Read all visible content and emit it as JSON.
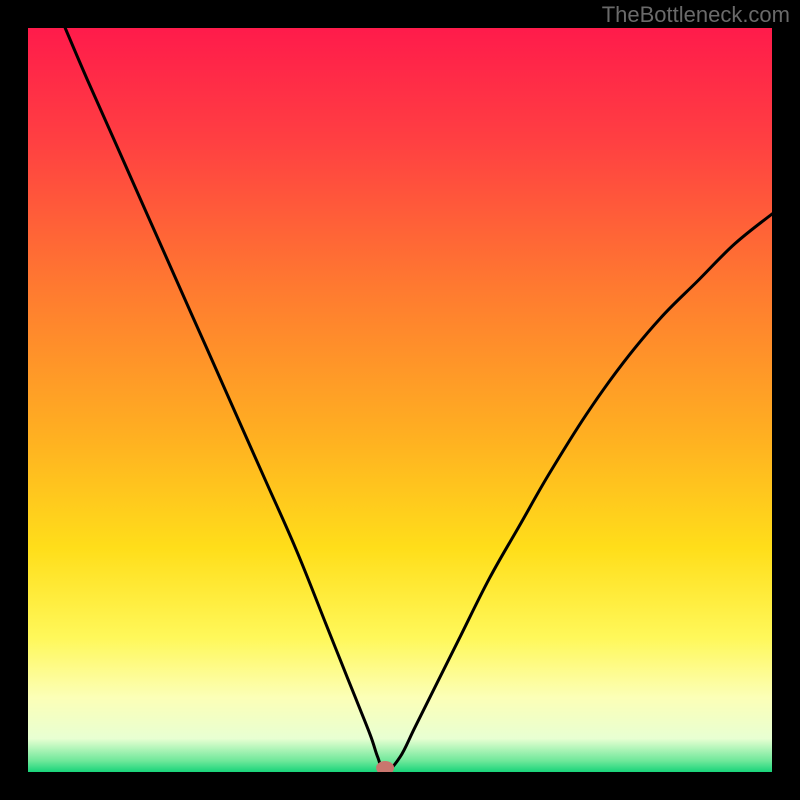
{
  "watermark": "TheBottleneck.com",
  "chart_data": {
    "type": "line",
    "title": "",
    "xlabel": "",
    "ylabel": "",
    "xlim": [
      0,
      100
    ],
    "ylim": [
      0,
      100
    ],
    "background_gradient_stops": [
      {
        "offset": 0,
        "color": "#ff1b4b"
      },
      {
        "offset": 0.15,
        "color": "#ff3f42"
      },
      {
        "offset": 0.35,
        "color": "#ff7a30"
      },
      {
        "offset": 0.55,
        "color": "#ffb021"
      },
      {
        "offset": 0.7,
        "color": "#ffde1a"
      },
      {
        "offset": 0.82,
        "color": "#fff85a"
      },
      {
        "offset": 0.9,
        "color": "#fcffb7"
      },
      {
        "offset": 0.955,
        "color": "#e8ffd2"
      },
      {
        "offset": 0.985,
        "color": "#6fe89a"
      },
      {
        "offset": 1.0,
        "color": "#18d47a"
      }
    ],
    "series": [
      {
        "name": "bottleneck-curve",
        "x": [
          5,
          8,
          12,
          16,
          20,
          24,
          28,
          32,
          36,
          40,
          42,
          44,
          46,
          47,
          48,
          50,
          52,
          55,
          58,
          62,
          66,
          70,
          75,
          80,
          85,
          90,
          95,
          100
        ],
        "y": [
          100,
          93,
          84,
          75,
          66,
          57,
          48,
          39,
          30,
          20,
          15,
          10,
          5,
          2,
          0,
          2,
          6,
          12,
          18,
          26,
          33,
          40,
          48,
          55,
          61,
          66,
          71,
          75
        ]
      }
    ],
    "marker": {
      "x": 48,
      "y": 0,
      "color": "#c9766e"
    }
  }
}
